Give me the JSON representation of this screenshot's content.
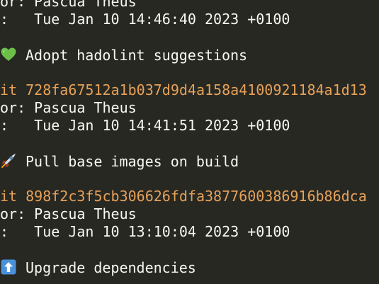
{
  "colors": {
    "background": "#272822",
    "foreground": "#f8f8f2",
    "commit_hash": "#e6a15a",
    "heart": "#6cc04a",
    "arrow_box": "#4a90d9"
  },
  "log": {
    "top_author_line": "or: Pascua Theus",
    "top_date_line": ":   Tue Jan 10 14:46:40 2023 +0100",
    "entries": [
      {
        "icon": "green-heart-icon",
        "subject": "Adopt hadolint suggestions",
        "commit_line": "it 728fa67512a1b037d9d4a158a4100921184a1d13",
        "author_line": "or: Pascua Theus",
        "date_line": ":   Tue Jan 10 14:41:51 2023 +0100"
      },
      {
        "icon": "rocket-icon",
        "subject": "Pull base images on build",
        "commit_line": "it 898f2c3f5cb306626fdfa3877600386916b86dca",
        "author_line": "or: Pascua Theus",
        "date_line": ":   Tue Jan 10 13:10:04 2023 +0100"
      },
      {
        "icon": "up-arrow-icon",
        "subject": "Upgrade dependencies",
        "commit_line": "",
        "author_line": "",
        "date_line": ""
      }
    ]
  }
}
